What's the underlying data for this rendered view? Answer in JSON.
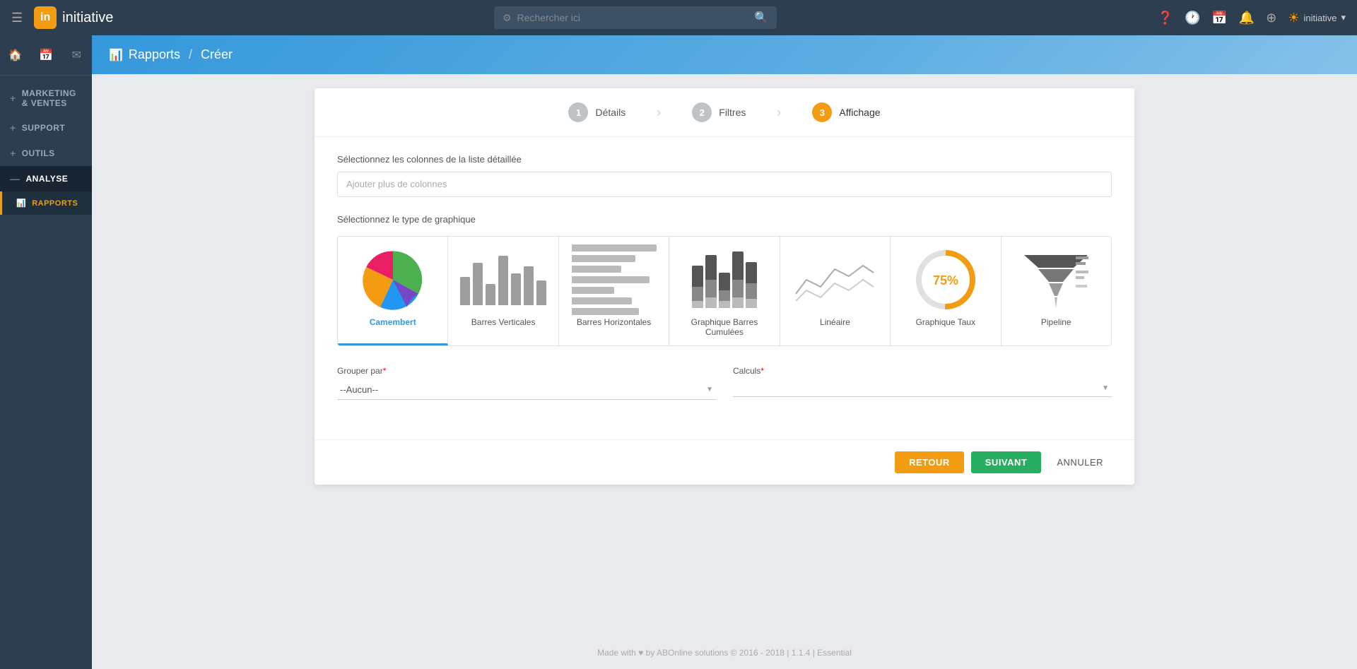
{
  "app": {
    "logo_letter": "in",
    "brand": "initiative",
    "user": "initiative"
  },
  "topnav": {
    "search_placeholder": "Rechercher ici",
    "icons": {
      "help": "?",
      "history": "🕐",
      "calendar": "📅",
      "notifications": "🔔",
      "add": "⊕"
    }
  },
  "sidebar": {
    "quick_icons": [
      "🏠",
      "📅",
      "✉"
    ],
    "items": [
      {
        "id": "marketing",
        "label": "MARKETING & VENTES",
        "prefix": "+"
      },
      {
        "id": "support",
        "label": "SUPPORT",
        "prefix": "+"
      },
      {
        "id": "outils",
        "label": "OUTILS",
        "prefix": "+"
      },
      {
        "id": "analyse",
        "label": "ANALYSE",
        "prefix": "—"
      }
    ],
    "submenu": [
      {
        "id": "rapports",
        "label": "Rapports",
        "active": true
      }
    ]
  },
  "breadcrumb": {
    "section": "Rapports",
    "separator": "/",
    "current": "Créer"
  },
  "wizard": {
    "steps": [
      {
        "id": "details",
        "number": "1",
        "label": "Détails",
        "state": "done"
      },
      {
        "id": "filtres",
        "number": "2",
        "label": "Filtres",
        "state": "done"
      },
      {
        "id": "affichage",
        "number": "3",
        "label": "Affichage",
        "state": "active"
      }
    ],
    "columns_label": "Sélectionnez les colonnes de la liste détaillée",
    "columns_placeholder": "Ajouter plus de colonnes",
    "chart_type_label": "Sélectionnez le type de graphique",
    "chart_options": [
      {
        "id": "camembert",
        "label": "Camembert",
        "selected": true
      },
      {
        "id": "barres-verticales",
        "label": "Barres Verticales",
        "selected": false
      },
      {
        "id": "barres-horizontales",
        "label": "Barres Horizontales",
        "selected": false
      },
      {
        "id": "graphique-barres-cumulees",
        "label": "Graphique Barres Cumulées",
        "selected": false
      },
      {
        "id": "lineaire",
        "label": "Linéaire",
        "selected": false
      },
      {
        "id": "graphique-taux",
        "label": "Graphique Taux",
        "selected": false
      },
      {
        "id": "pipeline",
        "label": "Pipeline",
        "selected": false
      }
    ],
    "groupby_label": "Grouper par",
    "groupby_required": "*",
    "groupby_value": "--Aucun--",
    "calculs_label": "Calculs",
    "calculs_required": "*",
    "calculs_value": "",
    "buttons": {
      "back": "RETOUR",
      "next": "SUIVANT",
      "cancel": "ANNULER"
    }
  },
  "footer": {
    "text": "Made with ♥ by ABOnline solutions © 2016 - 2018 | 1.1.4 | Essential"
  }
}
